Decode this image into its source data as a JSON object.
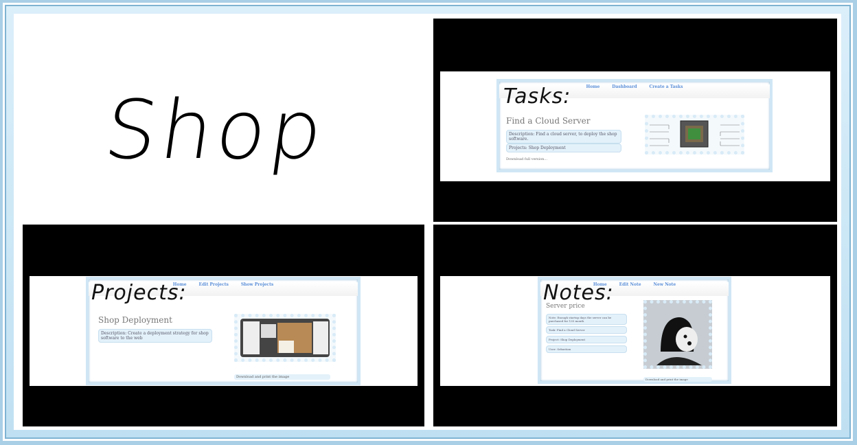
{
  "title": {
    "text": "Shop"
  },
  "tasks": {
    "heading": "Tasks:",
    "nav": [
      "Home",
      "Dashboard",
      "Create a Tasks"
    ],
    "task_title": "Find a Cloud Server",
    "description": "Description: Find a cloud server, to deploy the shop software.",
    "project": "Projects: Shop Deployment",
    "download": "Download full version..."
  },
  "projects": {
    "heading": "Projects:",
    "nav": [
      "Home",
      "Edit Projects",
      "Show Projects"
    ],
    "project_title": "Shop Deployment",
    "description": "Description: Create a deployment strategy for shop software to the web",
    "download": "Download and print the image"
  },
  "notes": {
    "heading": "Notes:",
    "nav": [
      "Home",
      "Edit Note",
      "New Note"
    ],
    "note_title": "Server price",
    "note": "Note: Enough startup days the server can be purchased for 135 month",
    "task": "Task: Find a Cloud Server",
    "project": "Project: Shop Deployment",
    "user": "User: Sebastian",
    "download": "Download and print the image"
  },
  "colors": {
    "frame": "#a9cfe6",
    "accent": "#5b8fd8",
    "field_bg": "#e3f1fa"
  }
}
